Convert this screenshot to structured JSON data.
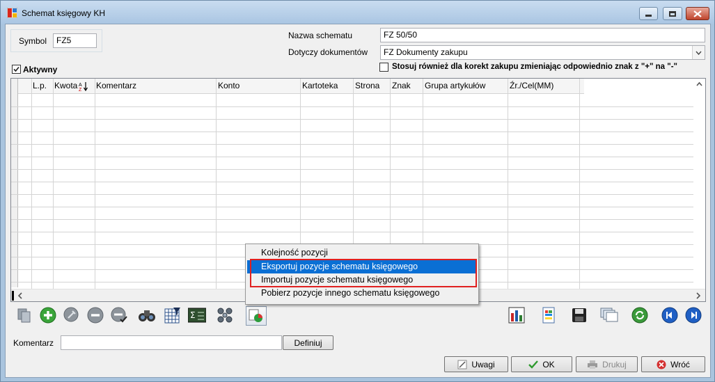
{
  "window": {
    "title": "Schemat księgowy KH",
    "controls": [
      "minimize",
      "maximize",
      "close"
    ]
  },
  "form": {
    "symbol_label": "Symbol",
    "symbol_value": "FZ5",
    "schema_name_label": "Nazwa schematu",
    "schema_name_value": "FZ 50/50",
    "documents_label": "Dotyczy dokumentów",
    "documents_value": "FZ Dokumenty zakupu",
    "active_label": "Aktywny",
    "active_checked": true,
    "correction_label": "Stosuj również dla korekt zakupu zmieniając odpowiednio znak z \"+\" na \"-\"",
    "correction_checked": false
  },
  "grid": {
    "columns": [
      "L.p.",
      "Kwota",
      "Komentarz",
      "Konto",
      "Kartoteka",
      "Strona",
      "Znak",
      "Grupa artykułów",
      "Źr./Cel(MM)"
    ],
    "row_count": 14,
    "sort_indicator_icon": "sort-az-icon"
  },
  "context_menu": {
    "items": [
      {
        "label": "Kolejność pozycji",
        "state": "normal"
      },
      {
        "label": "Eksportuj pozycje schematu księgowego",
        "state": "highlighted-selected"
      },
      {
        "label": "Importuj pozycje schematu księgowego",
        "state": "highlighted"
      },
      {
        "label": "Pobierz pozycje innego schematu księgowego",
        "state": "normal"
      }
    ],
    "highlight_color": "#e02020",
    "selection_color": "#0a6fd4"
  },
  "toolbar": {
    "left_icons": [
      "copy-icon",
      "add-icon",
      "edit-icon",
      "remove-icon",
      "remove-checked-icon",
      "binoculars-icon",
      "table-filter-icon",
      "sum-icon",
      "molecule-icon",
      "import-export-icon"
    ],
    "right_icons": [
      "chart-icon",
      "document-icon",
      "save-icon",
      "windows-icon",
      "refresh-icon",
      "prev-icon",
      "next-icon"
    ]
  },
  "footer": {
    "comment_label": "Komentarz",
    "comment_value": "",
    "define_button": "Definiuj",
    "notes_button": "Uwagi",
    "ok_button": "OK",
    "print_button": "Drukuj",
    "back_button": "Wróć"
  }
}
